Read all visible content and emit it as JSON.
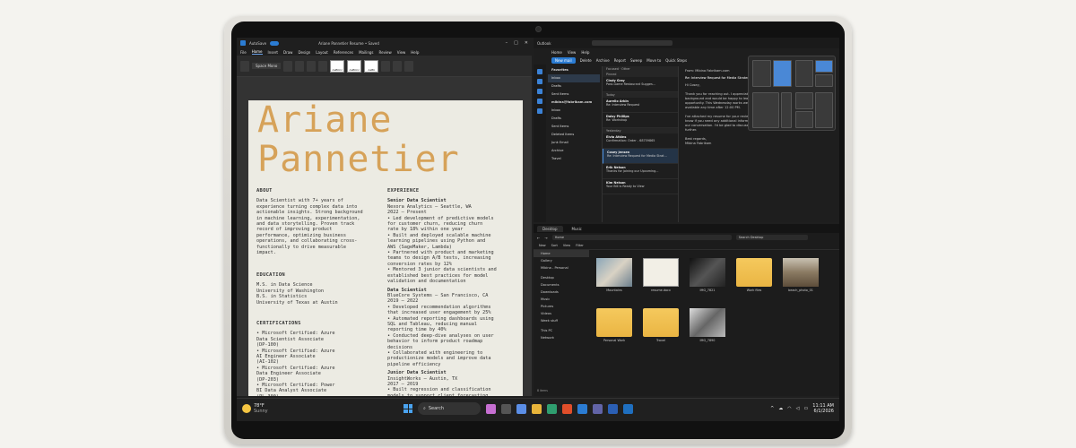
{
  "word": {
    "title": "Ariane Pannetier Resume • Saved",
    "autosave": "AutoSave",
    "menu": [
      "File",
      "Home",
      "Insert",
      "Draw",
      "Design",
      "Layout",
      "References",
      "Mailings",
      "Review",
      "View",
      "Help"
    ],
    "active_menu": "Home",
    "font_name": "Space Mono",
    "styles": [
      "AaBbCc",
      "AaBbCc",
      "AaBb"
    ],
    "first_name": "Ariane",
    "last_name": "Pannetier",
    "about_title": "ABOUT",
    "about_text": "Data Scientist with 7+ years of\nexperience turning complex data into\nactionable insights. Strong background\nin machine learning, experimentation,\nand data storytelling. Proven track\nrecord of improving product\nperformance, optimizing business\noperations, and collaborating cross-\nfunctionally to drive measurable\nimpact.",
    "education_title": "EDUCATION",
    "education_text": "M.S. in Data Science\n University of Washington\nB.S. in Statistics\n University of Texas at Austin",
    "cert_title": "CERTIFICATIONS",
    "cert_text": "• Microsoft Certified: Azure\n  Data Scientist Associate\n  (DP-100)\n• Microsoft Certified: Azure\n  AI Engineer Associate\n  (AI-102)\n• Microsoft Certified: Azure\n  Data Engineer Associate\n  (DP-203)\n• Microsoft Certified: Power\n  BI Data Analyst Associate\n  (PL-300)",
    "exp_title": "EXPERIENCE",
    "job1_title": "Senior Data Scientist",
    "job1_meta": "Nexora Analytics — Seattle, WA\n2022 – Present",
    "job1_text": "• Led development of predictive models\n  for customer churn, reducing churn\n  rate by 18% within one year\n• Built and deployed scalable machine\n  learning pipelines using Python and\n  AWS (SageMaker, Lambda)\n• Partnered with product and marketing\n  teams to design A/B tests, increasing\n  conversion rates by 12%\n• Mentored 3 junior data scientists and\n  established best practices for model\n  validation and documentation",
    "job2_title": "Data Scientist",
    "job2_meta": "BlueCore Systems — San Francisco, CA\n2019 – 2022",
    "job2_text": "• Developed recommendation algorithms\n  that increased user engagement by 25%\n• Automated reporting dashboards using\n  SQL and Tableau, reducing manual\n  reporting time by 40%\n• Conducted deep-dive analyses on user\n  behavior to inform product roadmap\n  decisions\n• Collaborated with engineering to\n  productionize models and improve data\n  pipeline efficiency",
    "job3_title": "Junior Data Scientist",
    "job3_meta": "InsightWorks — Austin, TX\n2017 – 2019",
    "job3_text": "• Built regression and classification\n  models to support client forecasting",
    "status": "Page 1 of 1   483 words   Accessibility: Good to go"
  },
  "outlook": {
    "app": "Outlook",
    "menu": [
      "Home",
      "View",
      "Help"
    ],
    "new_mail": "New mail",
    "tools": [
      "Delete",
      "Archive",
      "Report",
      "Sweep",
      "Move to",
      "Quick Steps"
    ],
    "folders_header": "Favorites",
    "folders": [
      "Inbox",
      "Drafts",
      "Sent Items",
      "mibina@fabrikam.com",
      "Inbox",
      "Drafts",
      "Sent Items",
      "Deleted Items",
      "Junk Email",
      "Archive",
      "Travel"
    ],
    "list_tabs": [
      "Focused",
      "Other"
    ],
    "groups": [
      "Pinned",
      "Today",
      "Yesterday"
    ],
    "messages": [
      {
        "from": "Cindy Gray",
        "subject": "Post-Game Restaurant Sugges..."
      },
      {
        "from": "Aurelio Arkin",
        "subject": "Re: Interview Request"
      },
      {
        "from": "Daisy Phillips",
        "subject": "Re: Workshop"
      },
      {
        "from": "Elvia Atkins",
        "subject": "Confirmation: Order - 68759865"
      },
      {
        "from": "Cosey Jensen",
        "subject": "Re: Interview Request for Media Strat..."
      },
      {
        "from": "Erik Nelson",
        "subject": "Thanks for joining our Upcoming..."
      },
      {
        "from": "Kim Nelson",
        "subject": "Your Bill is Ready to View"
      }
    ],
    "reading_from": "From: Mibina Fabrikam.com",
    "reading_subject": "Re: Interview Request for Media Strategist",
    "reading_body": "Hi Cosey,\n\nThank you for reaching out. I appreciate your interest in my background and would be happy to learn more about the opportunity. This Wednesday works well for me, and I am available any time after 12:00 PM.\n\nI've attached my resume for your review. Please let me know if you need any additional information in advance of our conversation. I'd be glad to discuss my experience further.\n\nBest regards,\nMibina Fabrikam"
  },
  "explorer": {
    "tabs": [
      "Desktop",
      "Music"
    ],
    "address": "Home",
    "search": "Search Desktop",
    "commands": [
      "New",
      "Sort",
      "View",
      "Filter"
    ],
    "nav": [
      "Home",
      "Gallery",
      "Mibina - Personal",
      "Desktop",
      "Documents",
      "Downloads",
      "Music",
      "Pictures",
      "Videos",
      "Week stuff",
      "This PC",
      "Network"
    ],
    "files": [
      {
        "name": "Mountains",
        "kind": "img"
      },
      {
        "name": "resume.docx",
        "kind": "doc"
      },
      {
        "name": "IMG_7821",
        "kind": "dark"
      },
      {
        "name": "Work files",
        "kind": "folder"
      },
      {
        "name": "beach_photo_01",
        "kind": "photo"
      },
      {
        "name": "Personal Work",
        "kind": "folder"
      },
      {
        "name": "Travel",
        "kind": "folder"
      },
      {
        "name": "IMG_7890",
        "kind": "bw"
      }
    ],
    "status": "8 items"
  },
  "taskbar": {
    "temp": "78°F",
    "condition": "Sunny",
    "search": "Search",
    "time": "11:11 AM",
    "date": "6/1/2026"
  }
}
